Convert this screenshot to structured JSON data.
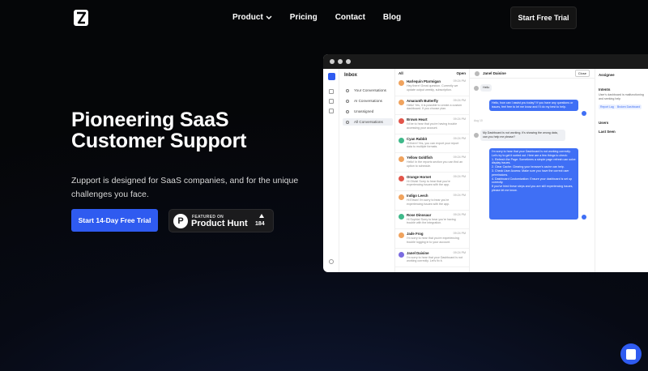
{
  "nav": {
    "links": [
      "Product",
      "Pricing",
      "Contact",
      "Blog"
    ],
    "cta": "Start Free Trial"
  },
  "hero": {
    "title_line1": "Pioneering SaaS",
    "title_line2": "Customer Support",
    "subtitle": "Zupport is designed for SaaS companies, and for the unique challenges you face.",
    "primary_cta": "Start 14-Day Free Trial",
    "product_hunt": {
      "small": "FEATURED ON",
      "big": "Product Hunt",
      "count": "184"
    }
  },
  "app": {
    "sidebar": {
      "title": "Inbox",
      "items": [
        "Your Conversations",
        "AI Conversations",
        "Unassigned",
        "All Conversations"
      ]
    },
    "list": {
      "filter": "All",
      "sort": "Open",
      "conversations": [
        {
          "name": "Harlequin Ptarmigan",
          "time": "09:24 PM",
          "preview": "Hey there! Great question. Currently we update output weekly, subscription.",
          "color": "#f0a35e"
        },
        {
          "name": "Amaranth Butterfly",
          "time": "09:24 PM",
          "preview": "Hello! Yes, it is possible to create a custom dashboard. If you choose plan.",
          "color": "#f0a35e"
        },
        {
          "name": "Brown Heart",
          "time": "09:24 PM",
          "preview": "I'd be to hear that you're having trouble accessing your account.",
          "color": "#e2554a"
        },
        {
          "name": "Cyan Rabbit",
          "time": "09:24 PM",
          "preview": "Hi there! Yes, you can export your report data to multiple formats.",
          "color": "#3fb98a"
        },
        {
          "name": "Yellow Goldfish",
          "time": "09:24 PM",
          "preview": "Hello! In the reports section you can find an option to schedule.",
          "color": "#f0a35e"
        },
        {
          "name": "Orange Hornet",
          "time": "09:24 PM",
          "preview": "Hi Olivia! Sorry to hear that you're experiencing issues with the app.",
          "color": "#e2554a"
        },
        {
          "name": "Indigo Leech",
          "time": "09:24 PM",
          "preview": "Hi Ethan! I'm sorry to hear you're experiencing issues with the app.",
          "color": "#f0a35e"
        },
        {
          "name": "Rose Dinosaur",
          "time": "09:24 PM",
          "preview": "Hi Sophia! Sorry to hear you're having trouble with the integration.",
          "color": "#3fb98a"
        },
        {
          "name": "Jade Frog",
          "time": "09:24 PM",
          "preview": "I'm sorry to hear that you're experiencing trouble logging in to your account.",
          "color": "#f0a35e"
        },
        {
          "name": "Janel Daisine",
          "time": "09:24 PM",
          "preview": "I'm sorry to hear that your Dashboard is not working correctly. Let's fix it.",
          "color": "#7a6be0"
        }
      ]
    },
    "chat": {
      "contact": "Janel Daisine",
      "close_label": "Close",
      "msg1": "Hello",
      "msg2": "Hello, how can I assist you today? If you have any questions or issues, feel free to let me know and I'll do my best to help.",
      "msg3": "My Dashboard is not working. It's showing the wrong data, can you help me please?",
      "msg4": "I'm sorry to hear that your Dashboard is not working correctly. Let's try to get it sorted out. Here are a few things to check:\n1. Refresh the Page: Sometimes a simple page refresh can solve display issues.\n2. Clear Cache: Clearing your browser's cache can help.\n3. Check User Access: Make sure you have the correct user permissions.\n4. Dashboard Customization: Ensure your dashboard is set up correctly.\nIf you've tried these steps and you are still experiencing issues, please let me know.",
      "stamp": "Aug 10"
    },
    "details": {
      "h1": "Assignee",
      "h2": "Intents",
      "t2": "User's dashboard is malfunctioning and seeking help",
      "tag1": "Report Lag",
      "tag2": "Broken Dashboard",
      "h3": "Users",
      "h4": "Last Seen"
    }
  }
}
